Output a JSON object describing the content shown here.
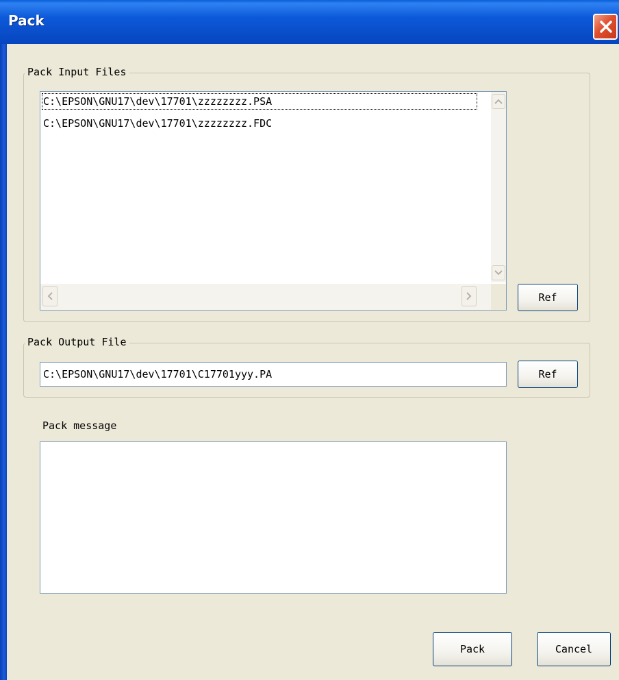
{
  "window": {
    "title": "Pack"
  },
  "input_group": {
    "title": "Pack Input Files",
    "files": [
      "C:\\EPSON\\GNU17\\dev\\17701\\zzzzzzzz.PSA",
      "C:\\EPSON\\GNU17\\dev\\17701\\zzzzzzzz.FDC"
    ],
    "ref_label": "Ref"
  },
  "output_group": {
    "title": "Pack Output File",
    "value": "C:\\EPSON\\GNU17\\dev\\17701\\C17701yyy.PA",
    "ref_label": "Ref"
  },
  "message": {
    "label": "Pack message",
    "value": ""
  },
  "buttons": {
    "pack": "Pack",
    "cancel": "Cancel"
  }
}
